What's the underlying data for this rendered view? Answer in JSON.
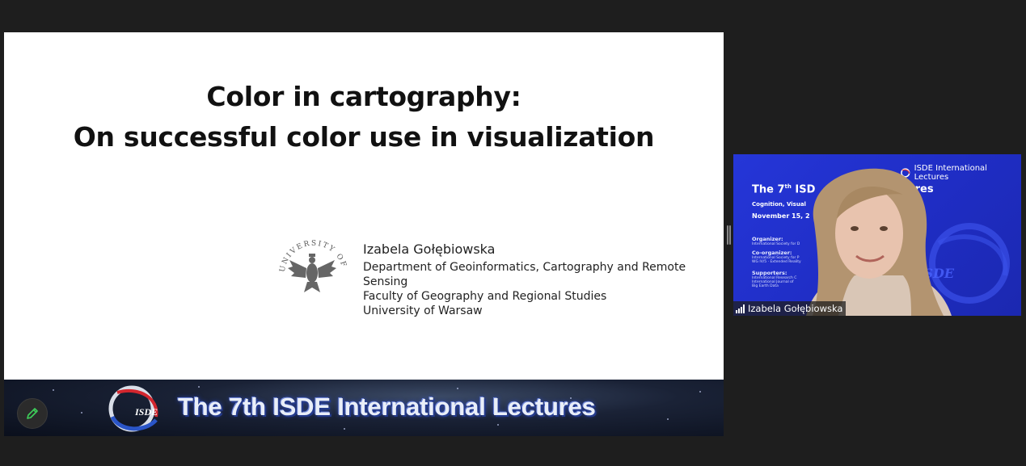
{
  "slide": {
    "title_line1": "Color in cartography:",
    "title_line2": "On successful color use in visualization",
    "seal_text": "UNIVERSITY OF WARSAW",
    "author_name": "Izabela Gołębiowska",
    "affiliation_lines": [
      "Department of Geoinformatics, Cartography and Remote Sensing",
      "Faculty of Geography and Regional Studies",
      "University of Warsaw"
    ]
  },
  "banner": {
    "logo_text": "ISDE",
    "title": "The 7th ISDE International Lectures",
    "annotate_icon": "pencil-icon"
  },
  "video": {
    "brand": "ISDE International Lectures",
    "title_a": "The 7",
    "title_sup": "th",
    "title_b": " ISD",
    "title_c": "l Lectures",
    "subtitle": "Cognition, Visual",
    "date": "November 15, 2",
    "organizer_label": "Organizer:",
    "organizer_value": "International Society for D",
    "coorganizer_label": "Co-organizer:",
    "coorganizer_lines": [
      "International Society for P",
      "WG IV/5 · Extended Reality"
    ],
    "supporters_label": "Supporters:",
    "supporters_lines": [
      "International Research C",
      "International Journal of",
      "Big Earth Data"
    ],
    "watermark": "ISDE",
    "participant_name": "Izabela Gołębiowska",
    "signal_icon": "signal-bars-icon"
  },
  "colors": {
    "app_background": "#1e1e1e",
    "slide_background": "#ffffff",
    "video_background": "#2536d8",
    "banner_title": "#e9eef8"
  }
}
